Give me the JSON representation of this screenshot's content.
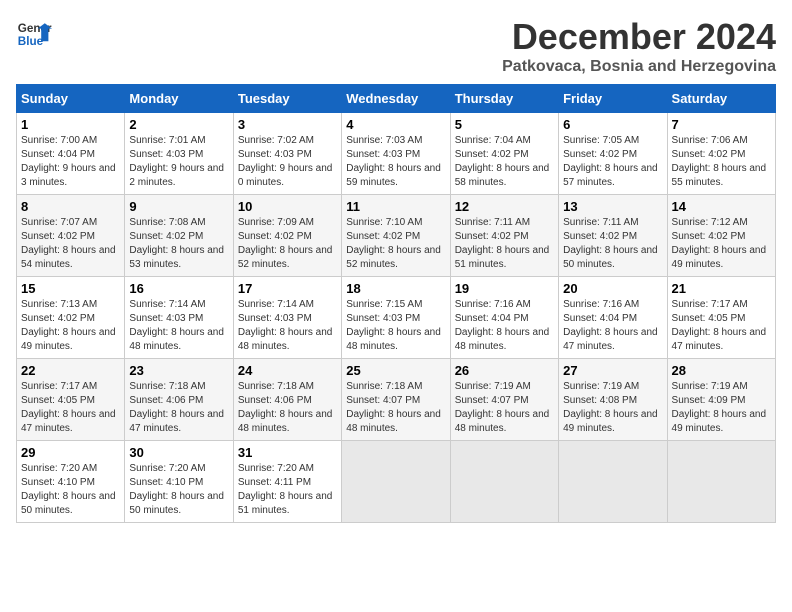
{
  "header": {
    "logo_line1": "General",
    "logo_line2": "Blue",
    "title": "December 2024",
    "subtitle": "Patkovaca, Bosnia and Herzegovina"
  },
  "weekdays": [
    "Sunday",
    "Monday",
    "Tuesday",
    "Wednesday",
    "Thursday",
    "Friday",
    "Saturday"
  ],
  "weeks": [
    [
      {
        "day": "1",
        "info": "Sunrise: 7:00 AM\nSunset: 4:04 PM\nDaylight: 9 hours and 3 minutes."
      },
      {
        "day": "2",
        "info": "Sunrise: 7:01 AM\nSunset: 4:03 PM\nDaylight: 9 hours and 2 minutes."
      },
      {
        "day": "3",
        "info": "Sunrise: 7:02 AM\nSunset: 4:03 PM\nDaylight: 9 hours and 0 minutes."
      },
      {
        "day": "4",
        "info": "Sunrise: 7:03 AM\nSunset: 4:03 PM\nDaylight: 8 hours and 59 minutes."
      },
      {
        "day": "5",
        "info": "Sunrise: 7:04 AM\nSunset: 4:02 PM\nDaylight: 8 hours and 58 minutes."
      },
      {
        "day": "6",
        "info": "Sunrise: 7:05 AM\nSunset: 4:02 PM\nDaylight: 8 hours and 57 minutes."
      },
      {
        "day": "7",
        "info": "Sunrise: 7:06 AM\nSunset: 4:02 PM\nDaylight: 8 hours and 55 minutes."
      }
    ],
    [
      {
        "day": "8",
        "info": "Sunrise: 7:07 AM\nSunset: 4:02 PM\nDaylight: 8 hours and 54 minutes."
      },
      {
        "day": "9",
        "info": "Sunrise: 7:08 AM\nSunset: 4:02 PM\nDaylight: 8 hours and 53 minutes."
      },
      {
        "day": "10",
        "info": "Sunrise: 7:09 AM\nSunset: 4:02 PM\nDaylight: 8 hours and 52 minutes."
      },
      {
        "day": "11",
        "info": "Sunrise: 7:10 AM\nSunset: 4:02 PM\nDaylight: 8 hours and 52 minutes."
      },
      {
        "day": "12",
        "info": "Sunrise: 7:11 AM\nSunset: 4:02 PM\nDaylight: 8 hours and 51 minutes."
      },
      {
        "day": "13",
        "info": "Sunrise: 7:11 AM\nSunset: 4:02 PM\nDaylight: 8 hours and 50 minutes."
      },
      {
        "day": "14",
        "info": "Sunrise: 7:12 AM\nSunset: 4:02 PM\nDaylight: 8 hours and 49 minutes."
      }
    ],
    [
      {
        "day": "15",
        "info": "Sunrise: 7:13 AM\nSunset: 4:02 PM\nDaylight: 8 hours and 49 minutes."
      },
      {
        "day": "16",
        "info": "Sunrise: 7:14 AM\nSunset: 4:03 PM\nDaylight: 8 hours and 48 minutes."
      },
      {
        "day": "17",
        "info": "Sunrise: 7:14 AM\nSunset: 4:03 PM\nDaylight: 8 hours and 48 minutes."
      },
      {
        "day": "18",
        "info": "Sunrise: 7:15 AM\nSunset: 4:03 PM\nDaylight: 8 hours and 48 minutes."
      },
      {
        "day": "19",
        "info": "Sunrise: 7:16 AM\nSunset: 4:04 PM\nDaylight: 8 hours and 48 minutes."
      },
      {
        "day": "20",
        "info": "Sunrise: 7:16 AM\nSunset: 4:04 PM\nDaylight: 8 hours and 47 minutes."
      },
      {
        "day": "21",
        "info": "Sunrise: 7:17 AM\nSunset: 4:05 PM\nDaylight: 8 hours and 47 minutes."
      }
    ],
    [
      {
        "day": "22",
        "info": "Sunrise: 7:17 AM\nSunset: 4:05 PM\nDaylight: 8 hours and 47 minutes."
      },
      {
        "day": "23",
        "info": "Sunrise: 7:18 AM\nSunset: 4:06 PM\nDaylight: 8 hours and 47 minutes."
      },
      {
        "day": "24",
        "info": "Sunrise: 7:18 AM\nSunset: 4:06 PM\nDaylight: 8 hours and 48 minutes."
      },
      {
        "day": "25",
        "info": "Sunrise: 7:18 AM\nSunset: 4:07 PM\nDaylight: 8 hours and 48 minutes."
      },
      {
        "day": "26",
        "info": "Sunrise: 7:19 AM\nSunset: 4:07 PM\nDaylight: 8 hours and 48 minutes."
      },
      {
        "day": "27",
        "info": "Sunrise: 7:19 AM\nSunset: 4:08 PM\nDaylight: 8 hours and 49 minutes."
      },
      {
        "day": "28",
        "info": "Sunrise: 7:19 AM\nSunset: 4:09 PM\nDaylight: 8 hours and 49 minutes."
      }
    ],
    [
      {
        "day": "29",
        "info": "Sunrise: 7:20 AM\nSunset: 4:10 PM\nDaylight: 8 hours and 50 minutes."
      },
      {
        "day": "30",
        "info": "Sunrise: 7:20 AM\nSunset: 4:10 PM\nDaylight: 8 hours and 50 minutes."
      },
      {
        "day": "31",
        "info": "Sunrise: 7:20 AM\nSunset: 4:11 PM\nDaylight: 8 hours and 51 minutes."
      },
      null,
      null,
      null,
      null
    ]
  ]
}
